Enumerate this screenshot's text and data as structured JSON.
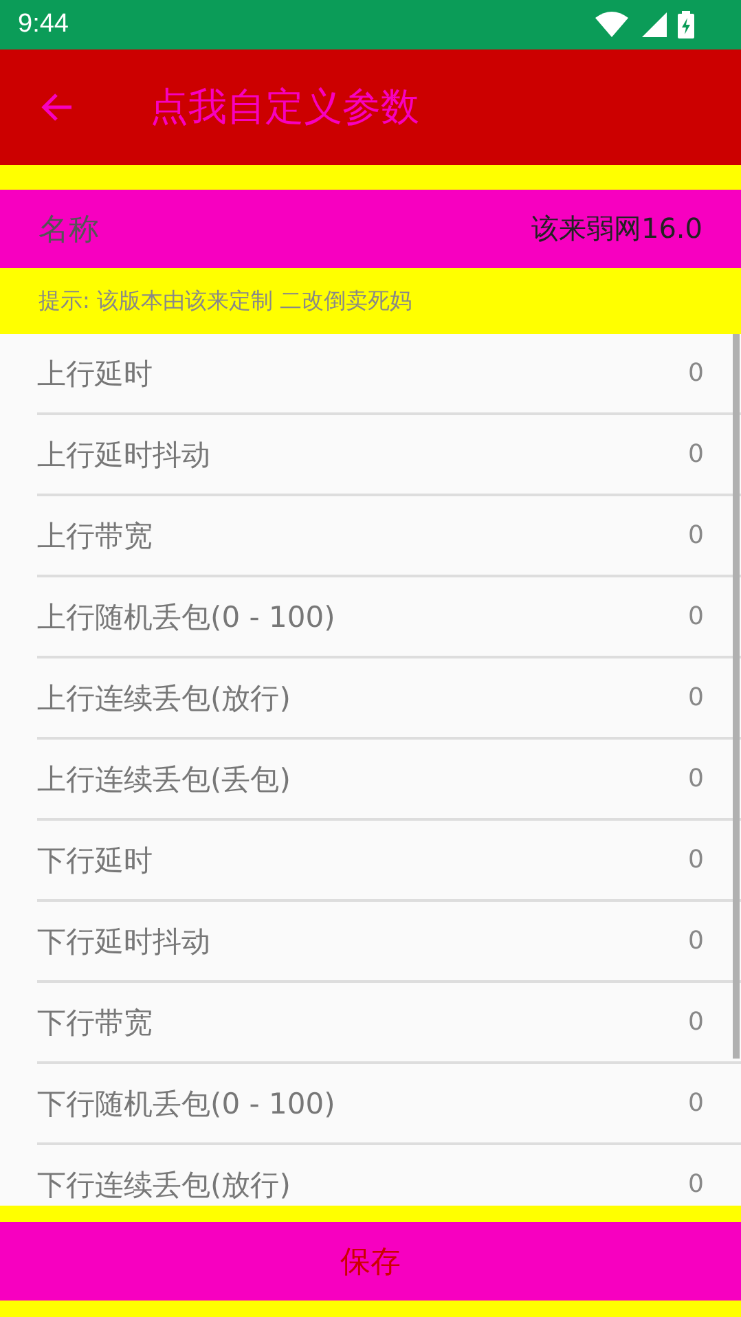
{
  "status_bar": {
    "time": "9:44"
  },
  "toolbar": {
    "title": "点我自定义参数"
  },
  "name_row": {
    "label": "名称",
    "value": "该来弱网16.0"
  },
  "hint": "提示: 该版本由该来定制  二改倒卖死妈",
  "params": [
    {
      "label": "上行延时",
      "value": "0"
    },
    {
      "label": "上行延时抖动",
      "value": "0"
    },
    {
      "label": "上行带宽",
      "value": "0"
    },
    {
      "label": "上行随机丢包(0 - 100)",
      "value": "0"
    },
    {
      "label": "上行连续丢包(放行)",
      "value": "0"
    },
    {
      "label": "上行连续丢包(丢包)",
      "value": "0"
    },
    {
      "label": "下行延时",
      "value": "0"
    },
    {
      "label": "下行延时抖动",
      "value": "0"
    },
    {
      "label": "下行带宽",
      "value": "0"
    },
    {
      "label": "下行随机丢包(0 - 100)",
      "value": "0"
    },
    {
      "label": "下行连续丢包(放行)",
      "value": "0"
    }
  ],
  "save_button": "保存"
}
